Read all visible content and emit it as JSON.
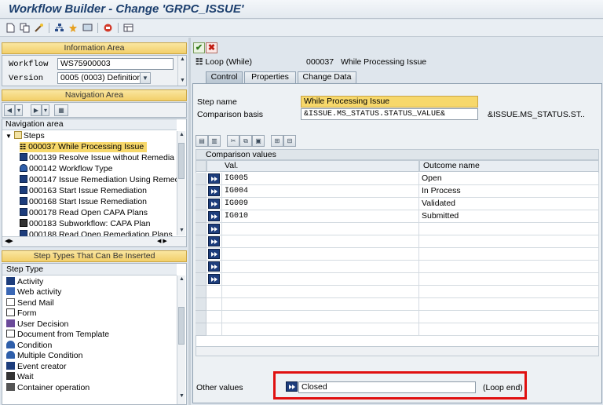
{
  "window": {
    "title": "Workflow Builder - Change 'GRPC_ISSUE'"
  },
  "info_area": {
    "header": "Information Area",
    "workflow_label": "Workflow",
    "workflow_value": "WS75900003",
    "version_label": "Version",
    "version_value": "0005 (0003) Definition"
  },
  "nav_area": {
    "header": "Navigation Area",
    "column_header": "Navigation area",
    "root": "Steps",
    "items": [
      {
        "label": "000037 While Processing Issue",
        "icon": "loop-icon",
        "selected": true
      },
      {
        "label": "000139 Resolve Issue without Remedia",
        "icon": "activity-icon"
      },
      {
        "label": "000142 Workflow Type",
        "icon": "multi-condition-icon"
      },
      {
        "label": "000147 Issue Remediation Using Remec",
        "icon": "activity-icon"
      },
      {
        "label": "000163 Start Issue Remediation",
        "icon": "activity-icon"
      },
      {
        "label": "000168 Start Issue Remediation",
        "icon": "activity-icon"
      },
      {
        "label": "000178 Read Open CAPA Plans",
        "icon": "activity-icon"
      },
      {
        "label": "000183 Subworkflow: CAPA Plan",
        "icon": "subworkflow-icon"
      },
      {
        "label": "000188 Read Open Remediation Plans",
        "icon": "activity-icon"
      }
    ]
  },
  "step_types": {
    "header": "Step Types That Can Be Inserted",
    "column_header": "Step Type",
    "items": [
      {
        "label": "Activity",
        "icon": "activity-icon"
      },
      {
        "label": "Web activity",
        "icon": "web-activity-icon"
      },
      {
        "label": "Send Mail",
        "icon": "mail-icon"
      },
      {
        "label": "Form",
        "icon": "form-icon"
      },
      {
        "label": "User Decision",
        "icon": "decision-icon"
      },
      {
        "label": "Document from Template",
        "icon": "document-icon"
      },
      {
        "label": "Condition",
        "icon": "condition-icon"
      },
      {
        "label": "Multiple Condition",
        "icon": "multi-condition-icon"
      },
      {
        "label": "Event creator",
        "icon": "event-icon"
      },
      {
        "label": "Wait",
        "icon": "wait-icon"
      },
      {
        "label": "Container operation",
        "icon": "container-icon"
      }
    ]
  },
  "detail": {
    "step_type_label": "Loop (While)",
    "step_number": "000037",
    "step_title": "While Processing Issue",
    "tabs": [
      "Control",
      "Properties",
      "Change Data"
    ],
    "active_tab": "Control",
    "step_name_label": "Step name",
    "step_name_value": "While Processing Issue",
    "comparison_basis_label": "Comparison basis",
    "comparison_basis_value": "&ISSUE.MS_STATUS.STATUS_VALUE&",
    "comparison_basis_text": "&ISSUE.MS_STATUS.ST..",
    "comparison_values_header": "Comparison values",
    "columns": [
      "Val.",
      "Outcome name"
    ],
    "rows": [
      {
        "val": "IG005",
        "outcome": "Open"
      },
      {
        "val": "IG004",
        "outcome": "In Process"
      },
      {
        "val": "IG009",
        "outcome": "Validated"
      },
      {
        "val": "IG010",
        "outcome": "Submitted"
      }
    ],
    "other_values_label": "Other values",
    "other_values_value": "Closed",
    "other_values_outcome": "(Loop end)"
  },
  "colors": {
    "highlight_border": "#e01010",
    "selected_row": "#f7d86b",
    "nav_header": "#f2cf6a"
  }
}
